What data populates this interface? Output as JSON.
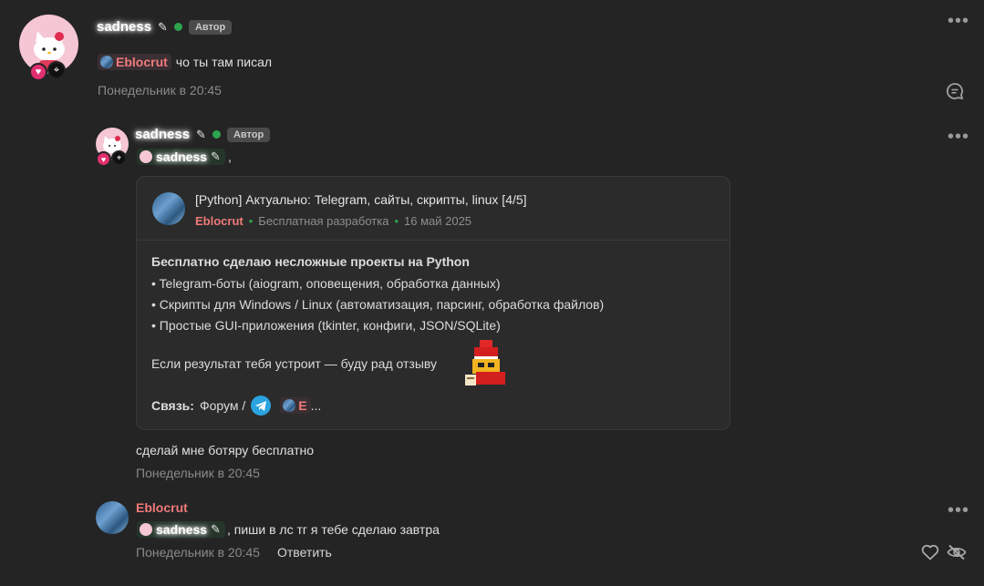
{
  "post1": {
    "author": "sadness",
    "role": "Автор",
    "mention": "Eblocrut",
    "text": "чо ты там писал",
    "time": "Понедельник в 20:45"
  },
  "post2": {
    "author": "sadness",
    "role": "Автор",
    "mention": "sadness",
    "mention_suffix": ",",
    "quote": {
      "title": "[Python] Актуально: Telegram, сайты, скрипты, linux [4/5]",
      "author": "Eblocrut",
      "category": "Бесплатная разработка",
      "date": "16 май 2025",
      "heading": "Бесплатно сделаю несложные проекты на Python",
      "bullets": [
        "• Telegram-боты (aiogram, оповещения, обработка данных)",
        "• Скрипты для Windows / Linux (автоматизация, парсинг, обработка файлов)",
        "• Простые GUI-приложения (tkinter, конфиги, JSON/SQLite)"
      ],
      "footer": "Если результат тебя устроит — буду рад отзыву",
      "contact_label": "Связь:",
      "contact_text": "Форум /",
      "contact_mention": "E",
      "contact_ellipsis": "..."
    },
    "text": "сделай мне ботяру бесплатно",
    "time": "Понедельник в 20:45"
  },
  "post3": {
    "author": "Eblocrut",
    "mention": "sadness",
    "text": ", пиши в лс тг я тебе сделаю завтра",
    "time": "Понедельник в 20:45",
    "reply_label": "Ответить"
  },
  "icons": {
    "more": "more-icon",
    "comment": "comment-icon",
    "like": "heart-icon",
    "hide": "eye-slash-icon"
  },
  "colors": {
    "background": "#242424",
    "mention": "#f07a7a",
    "online": "#2da44e",
    "telegram": "#2aa3e0"
  }
}
